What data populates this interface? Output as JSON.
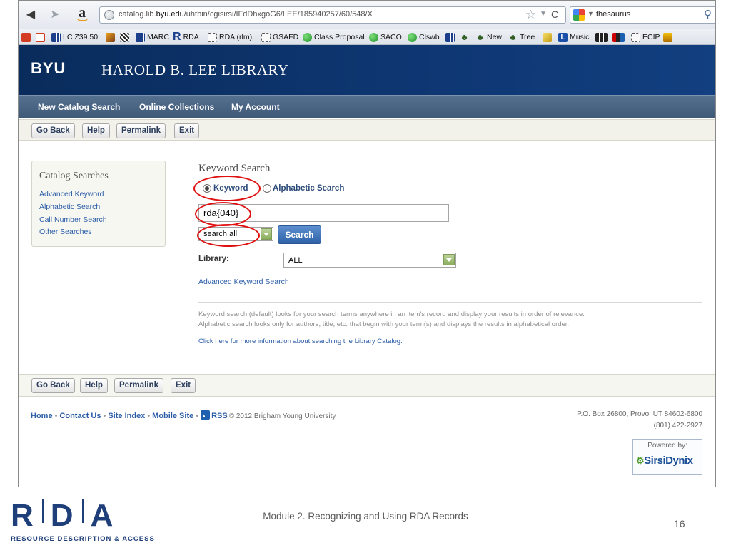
{
  "browser": {
    "url_prefix": "catalog.lib.",
    "url_domain": "byu.edu",
    "url_path": "/uhtbin/cgisirsi/IFdDhxgoG6/LEE/185940257/60/548/X",
    "search_engine_query": "thesaurus",
    "icons": [
      "back-arrow-icon",
      "forward-arrow-icon",
      "amazon-icon",
      "globe-icon",
      "star-icon",
      "reload-icon",
      "google-icon",
      "magnifier-icon",
      "home-icon"
    ]
  },
  "bookmarks": [
    {
      "label": "",
      "icon": "red"
    },
    {
      "label": "",
      "icon": "red"
    },
    {
      "label": "LC Z39.50",
      "icon": "book"
    },
    {
      "label": "",
      "icon": "gold"
    },
    {
      "label": "",
      "icon": "dots"
    },
    {
      "label": "MARC",
      "icon": "book"
    },
    {
      "label": "RDA",
      "icon": "R"
    },
    {
      "label": "RDA (rlm)",
      "icon": "folder"
    },
    {
      "label": "GSAFD",
      "icon": "folder"
    },
    {
      "label": "Class Proposal",
      "icon": "greencirc"
    },
    {
      "label": "SACO",
      "icon": "greencirc"
    },
    {
      "label": "Clswb",
      "icon": "greencirc"
    },
    {
      "label": "",
      "icon": "book"
    },
    {
      "label": "",
      "icon": "tree"
    },
    {
      "label": "New",
      "icon": "tree"
    },
    {
      "label": "Tree",
      "icon": "tree"
    },
    {
      "label": "",
      "icon": "gold"
    },
    {
      "label": "Music",
      "icon": "blueL"
    },
    {
      "label": "",
      "icon": "bbc"
    },
    {
      "label": "",
      "icon": "npr"
    },
    {
      "label": "ECIP",
      "icon": "folder"
    },
    {
      "label": "",
      "icon": "ecip"
    }
  ],
  "header": {
    "logo": "BYU",
    "title": "HAROLD B. LEE LIBRARY"
  },
  "nav": {
    "items": [
      "New Catalog Search",
      "Online Collections",
      "My Account"
    ]
  },
  "toolbar": {
    "buttons": [
      "Go Back",
      "Help",
      "Permalink",
      "Exit"
    ]
  },
  "sidebar": {
    "title": "Catalog Searches",
    "links": [
      "Advanced Keyword",
      "Alphabetic Search",
      "Call Number Search",
      "Other Searches"
    ]
  },
  "search": {
    "title": "Keyword Search",
    "radio_keyword": "Keyword",
    "radio_alpha": "Alphabetic Search",
    "radio_selected": "Keyword",
    "query": "rda{040}",
    "scope": "search all",
    "button": "Search",
    "library_label": "Library:",
    "library_value": "ALL",
    "advanced_link": "Advanced Keyword Search",
    "help_line1": "Keyword search (default) looks for your search terms anywhere in an item's record and display your results in order of relevance.",
    "help_line2": "Alphabetic search looks only for authors, title, etc. that begin with your term(s) and displays the results in alphabetical order.",
    "more_info_link": "Click here for more information about searching the Library Catalog."
  },
  "annotations": {
    "color": "#e01010",
    "highlighted": [
      "Keyword",
      "rda{040}",
      "search all"
    ]
  },
  "footer": {
    "links": [
      "Home",
      "Contact Us",
      "Site Index",
      "Mobile Site",
      "RSS"
    ],
    "copyright": "© 2012 Brigham Young University",
    "address1": "P.O. Box 26800, Provo, UT 84602-6800",
    "address2": "(801) 422-2927",
    "powered_label": "Powered by:",
    "powered_logo": "SirsiDynix"
  },
  "slide": {
    "logo": "RDA",
    "logo_tagline": "RESOURCE DESCRIPTION & ACCESS",
    "caption": "Module 2. Recognizing and Using RDA Records",
    "page_number": "16"
  }
}
